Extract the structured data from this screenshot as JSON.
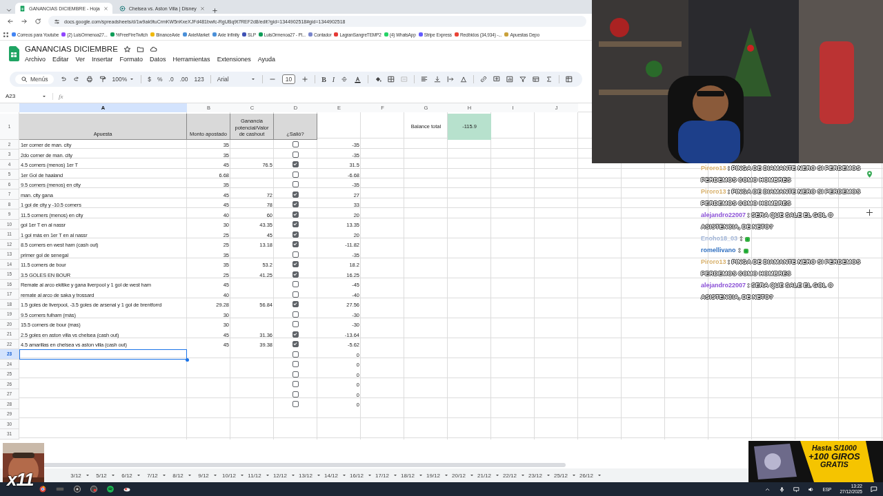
{
  "browser": {
    "tabs": [
      {
        "title": "GANANCIAS DICIEMBRE - Hoja",
        "selected": true
      },
      {
        "title": "Chelsea vs. Aston Villa | Disney",
        "selected": false
      }
    ],
    "address": "docs.google.com/spreadsheets/d/1w9ak9tuCrmKW5nKxeXJFd481bwfc-RgUBq9t7REF2d8/edit?gid=1344902518#gid=1344902518",
    "bookmarks": [
      {
        "label": "Correos para Youtube",
        "color": "#4285f4"
      },
      {
        "label": "(2) LuisOrmenoa27...",
        "color": "#9146ff"
      },
      {
        "label": "%FreeFireTwitch",
        "color": "#0f9d58"
      },
      {
        "label": "BinanceAxie",
        "color": "#f0b90b"
      },
      {
        "label": "AxieMarket",
        "color": "#4a90d9"
      },
      {
        "label": "Axie Infinity",
        "color": "#4a90d9"
      },
      {
        "label": "SLP",
        "color": "#3f51b5"
      },
      {
        "label": "LuisOrmenoa27 - Pl...",
        "color": "#0f9d58"
      },
      {
        "label": "Contador",
        "color": "#7986cb"
      },
      {
        "label": "LagranSangreTEMP2",
        "color": "#e53935"
      },
      {
        "label": "(4) WhatsApp",
        "color": "#25d366"
      },
      {
        "label": "Stripe Express",
        "color": "#635bff"
      },
      {
        "label": "Recibidos (34,934) -...",
        "color": "#ea4335"
      },
      {
        "label": "Apuestas Depo",
        "color": "#c9a13b"
      }
    ]
  },
  "document": {
    "title": "GANANCIAS DICIEMBRE",
    "menu": [
      "Archivo",
      "Editar",
      "Ver",
      "Insertar",
      "Formato",
      "Datos",
      "Herramientas",
      "Extensiones",
      "Ayuda"
    ]
  },
  "toolbar": {
    "search": "Menús",
    "zoom": "100%",
    "number_formats": [
      "$",
      "%",
      ".0",
      ".00",
      "123"
    ],
    "font": "Arial",
    "font_size": "10",
    "text_styles": [
      "B",
      "I"
    ]
  },
  "formula_bar": {
    "name_box": "A23",
    "fx": "fx"
  },
  "sheet": {
    "columns": [
      {
        "label": "A",
        "selected": true
      },
      {
        "label": "B",
        "selected": false
      },
      {
        "label": "C",
        "selected": false
      },
      {
        "label": "D",
        "selected": false
      },
      {
        "label": "E",
        "selected": false
      },
      {
        "label": "F",
        "selected": false
      },
      {
        "label": "G",
        "selected": false
      },
      {
        "label": "H",
        "selected": false
      },
      {
        "label": "I",
        "selected": false
      },
      {
        "label": "J",
        "selected": false
      }
    ],
    "header": {
      "num": "1",
      "apuesta": "Apuesta",
      "monto": "Monto apostado",
      "ganancia": "Ganancia potencial/Valor de cashout",
      "salio": "¿Salió?",
      "balance_label": "Balance total",
      "balance_value": "-115.9"
    },
    "rows": [
      {
        "num": "2",
        "apuesta": "1er corner de man. city",
        "monto": "35",
        "salio": false,
        "resultado": "-35",
        "selected": false
      },
      {
        "num": "3",
        "apuesta": "2do corner de man. city",
        "monto": "35",
        "salio": false,
        "resultado": "-35",
        "selected": false
      },
      {
        "num": "4",
        "apuesta": "4.5 corners (menos) 1er T",
        "monto": "45",
        "ganancia": "76.5",
        "salio": true,
        "resultado": "31.5",
        "selected": false
      },
      {
        "num": "5",
        "apuesta": "1er Gol de haaland",
        "monto": "6.68",
        "salio": false,
        "resultado": "-6.68",
        "selected": false
      },
      {
        "num": "6",
        "apuesta": "9.5 corners (menos) en city",
        "monto": "35",
        "salio": false,
        "resultado": "-35",
        "selected": false
      },
      {
        "num": "7",
        "apuesta": "man. city gana",
        "monto": "45",
        "ganancia": "72",
        "salio": true,
        "resultado": "27",
        "selected": false
      },
      {
        "num": "8",
        "apuesta": "1 gol de city y -10.5 corners",
        "monto": "45",
        "ganancia": "78",
        "salio": true,
        "resultado": "33",
        "selected": false
      },
      {
        "num": "9",
        "apuesta": "11.5 corners (menos) en city",
        "monto": "40",
        "ganancia": "60",
        "salio": true,
        "resultado": "20",
        "selected": false
      },
      {
        "num": "10",
        "apuesta": "gol 1er T en al nassr",
        "monto": "30",
        "ganancia": "43.35",
        "salio": true,
        "resultado": "13.35",
        "selected": false
      },
      {
        "num": "11",
        "apuesta": "1 gol más en 1er T en al nassr",
        "monto": "25",
        "ganancia": "45",
        "salio": true,
        "resultado": "20",
        "selected": false
      },
      {
        "num": "12",
        "apuesta": "8.5 corners en west ham (cash out)",
        "monto": "25",
        "ganancia": "13.18",
        "salio": true,
        "resultado": "-11.82",
        "selected": false
      },
      {
        "num": "13",
        "apuesta": "primer gol de senegal",
        "monto": "35",
        "salio": false,
        "resultado": "-35",
        "selected": false
      },
      {
        "num": "14",
        "apuesta": "11.5 corners de bour",
        "monto": "35",
        "ganancia": "53.2",
        "salio": true,
        "resultado": "18.2",
        "selected": false
      },
      {
        "num": "15",
        "apuesta": "3.5 GOLES EN BOUR",
        "monto": "25",
        "ganancia": "41.25",
        "salio": true,
        "resultado": "16.25",
        "selected": false
      },
      {
        "num": "16",
        "apuesta": "Remate al arco ekitike y gana liverpool y 1 gol de west ham",
        "monto": "45",
        "salio": false,
        "resultado": "-45",
        "selected": false
      },
      {
        "num": "17",
        "apuesta": "remate al arco de saka y trossard",
        "monto": "40",
        "salio": false,
        "resultado": "-40",
        "selected": false
      },
      {
        "num": "18",
        "apuesta": "1.5 goles de liverpool, -3.5 goles de arsenal y 1 gol de brentforrd",
        "monto": "29.28",
        "ganancia": "56.84",
        "salio": true,
        "resultado": "27.56",
        "selected": false
      },
      {
        "num": "19",
        "apuesta": "9.5 corners fulham (más)",
        "monto": "30",
        "salio": false,
        "resultado": "-30",
        "selected": false
      },
      {
        "num": "20",
        "apuesta": "15.5 corners de bour (mas)",
        "monto": "30",
        "salio": false,
        "resultado": "-30",
        "selected": false
      },
      {
        "num": "21",
        "apuesta": "2.5 goles en aston villa vs chelsea (cash out)",
        "monto": "45",
        "ganancia": "31.36",
        "salio": true,
        "resultado": "-13.64",
        "selected": false
      },
      {
        "num": "22",
        "apuesta": "4.5 amarillas en chelsea vs aston villa (cash out)",
        "monto": "45",
        "ganancia": "39.38",
        "salio": true,
        "resultado": "-5.62",
        "selected": false
      },
      {
        "num": "23",
        "salio": false,
        "resultado": "0",
        "selected": true
      },
      {
        "num": "24",
        "salio": false,
        "resultado": "0",
        "selected": false
      },
      {
        "num": "25",
        "salio": false,
        "resultado": "0",
        "selected": false
      },
      {
        "num": "26",
        "salio": false,
        "resultado": "0",
        "selected": false
      },
      {
        "num": "27",
        "salio": false,
        "resultado": "0",
        "selected": false
      },
      {
        "num": "28",
        "salio": false,
        "resultado": "0",
        "selected": false
      },
      {
        "num": "29",
        "selected": false
      },
      {
        "num": "30",
        "selected": false
      },
      {
        "num": "31",
        "selected": false
      }
    ]
  },
  "sheet_tabs": [
    "3/12",
    "5/12",
    "6/12",
    "7/12",
    "8/12",
    "9/12",
    "10/12",
    "11/12",
    "12/12",
    "13/12",
    "14/12",
    "16/12",
    "17/12",
    "18/12",
    "19/12",
    "20/12",
    "21/12",
    "22/12",
    "23/12",
    "25/12",
    "26/12"
  ],
  "taskbar": {
    "language": "ESP",
    "time": "13:22",
    "date": "27/12/2025"
  },
  "stream": {
    "chat": [
      {
        "kind": "text",
        "user": "Piroro13",
        "color": "#d8b06a",
        "text": ": PINGA DE DIAMANTE NERO SI PERDEMOS PERDEMOS COMO HOMBRES"
      },
      {
        "kind": "text",
        "user": "Piroro13",
        "color": "#d8b06a",
        "text": ": PINGA DE DIAMANTE NERO SI PERDEMOS PERDEMOS COMO HOMBRES"
      },
      {
        "kind": "text",
        "user": "alejandro22007",
        "color": "#8a4fd6",
        "text": ": SERA QUE SALE EL GOL O ASISTENCIA, DE NETO?"
      },
      {
        "kind": "emote",
        "user": "Enoho18_03",
        "color": "#9fb3d6",
        "text": ":"
      },
      {
        "kind": "emote",
        "user": "romellivano",
        "color": "#2f6fc0",
        "text": ":"
      },
      {
        "kind": "text",
        "user": "Piroro13",
        "color": "#d8b06a",
        "text": ": PINGA DE DIAMANTE NERO SI PERDEMOS PERDEMOS COMO HOMBRES"
      },
      {
        "kind": "text",
        "user": "alejandro22007",
        "color": "#8a4fd6",
        "text": ": SERA QUE SALE EL GOL O ASISTENCIA, DE NETO?"
      }
    ],
    "reaction": {
      "kind": "picture",
      "count": "x11"
    },
    "promo": {
      "kind": "picture",
      "lines": [
        "Hasta S/1000",
        "+100 GIROS",
        "GRATIS"
      ]
    }
  }
}
